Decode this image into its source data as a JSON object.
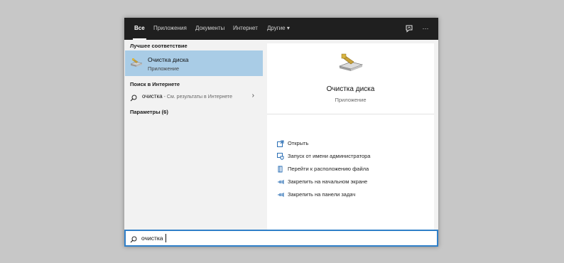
{
  "tabs": [
    {
      "label": "Все"
    },
    {
      "label": "Приложения"
    },
    {
      "label": "Документы"
    },
    {
      "label": "Интернет"
    },
    {
      "label": "Другие ▾"
    }
  ],
  "toolbar": {
    "feedback_icon": "feedback-icon",
    "more_label": "···"
  },
  "left_panel": {
    "best_match_header": "Лучшее соответствие",
    "best_match": {
      "title": "Очистка диска",
      "subtitle": "Приложение",
      "icon": "disk-cleanup-icon"
    },
    "web_header": "Поиск в Интернете",
    "web_item": {
      "query": "очистка",
      "suffix": " - См. результаты в Интернете"
    },
    "settings_header": "Параметры (6)"
  },
  "details": {
    "title": "Очистка диска",
    "subtitle": "Приложение",
    "actions": [
      {
        "label": "Открыть",
        "icon": "open-icon"
      },
      {
        "label": "Запуск от имени администратора",
        "icon": "shield-icon"
      },
      {
        "label": "Перейти к расположению файла",
        "icon": "folder-icon"
      },
      {
        "label": "Закрепить на начальном экране",
        "icon": "pin-icon"
      },
      {
        "label": "Закрепить на панели задач",
        "icon": "pin-icon"
      }
    ]
  },
  "search": {
    "value": "очистка"
  },
  "colors": {
    "accent": "#2f7fc8",
    "selection": "#a9cce6",
    "topbar": "#1f1f1f"
  }
}
